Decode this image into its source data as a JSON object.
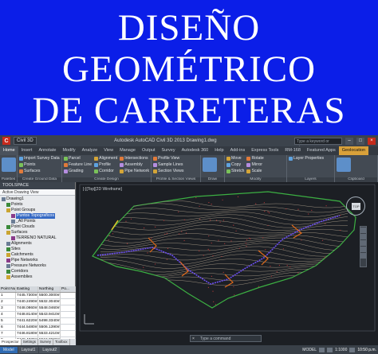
{
  "banner": {
    "line1": "DISEÑO",
    "line2": "GEOMÉTRICO",
    "line3": "DE CARRETERAS"
  },
  "titlebar": {
    "workspace": "Civil 3D",
    "document": "Autodesk AutoCAD Civil 3D 2013   Drawing1.dwg",
    "search_placeholder": "Type a keyword or phrase"
  },
  "ribbon_tabs": [
    "Home",
    "Insert",
    "Annotate",
    "Modify",
    "Analyze",
    "View",
    "Manage",
    "Output",
    "Survey",
    "Autodesk 360",
    "Help",
    "Add-ins",
    "Express Tools",
    "RM-168",
    "Featured Apps",
    "Geolocation"
  ],
  "ribbon_groups": [
    {
      "label": "Palettes",
      "items": []
    },
    {
      "label": "Create Ground Data",
      "items": [
        "Import Survey Data",
        "Points",
        "Surfaces"
      ]
    },
    {
      "label": "Create Design",
      "items": [
        "Parcel",
        "Feature Line",
        "Grading",
        "Alignment",
        "Profile",
        "Corridor",
        "Intersections",
        "Assembly",
        "Pipe Network"
      ]
    },
    {
      "label": "Profile & Section Views",
      "items": [
        "Profile View",
        "Sample Lines",
        "Section Views"
      ]
    },
    {
      "label": "Draw",
      "items": []
    },
    {
      "label": "Modify",
      "items": [
        "Move",
        "Copy",
        "Stretch",
        "Rotate",
        "Mirror",
        "Scale"
      ]
    },
    {
      "label": "Layers",
      "items": [
        "Layer Properties"
      ]
    },
    {
      "label": "Clipboard",
      "items": []
    }
  ],
  "toolspace": {
    "header": "TOOLSPACE",
    "mode": "Active Drawing View",
    "tree": [
      {
        "label": "Drawing1",
        "level": 0
      },
      {
        "label": "Points",
        "level": 1
      },
      {
        "label": "Point Groups",
        "level": 1
      },
      {
        "label": "Puntos Topograficos",
        "level": 2,
        "selected": true
      },
      {
        "label": "_All Points",
        "level": 2
      },
      {
        "label": "Point Clouds",
        "level": 1
      },
      {
        "label": "Surfaces",
        "level": 1
      },
      {
        "label": "TERRENO NATURAL",
        "level": 2
      },
      {
        "label": "Alignments",
        "level": 1
      },
      {
        "label": "Sites",
        "level": 1
      },
      {
        "label": "Catchments",
        "level": 1
      },
      {
        "label": "Pipe Networks",
        "level": 1
      },
      {
        "label": "Pressure Networks",
        "level": 1
      },
      {
        "label": "Corridors",
        "level": 1
      },
      {
        "label": "Assemblies",
        "level": 1
      }
    ],
    "table": {
      "headers": [
        "Point Nu...",
        "Easting",
        "Northing",
        "Po..."
      ],
      "rows": [
        [
          "1",
          "7445.7300m",
          "5500.3000m",
          ""
        ],
        [
          "2",
          "7440.2490m",
          "5532.3040m",
          ""
        ],
        [
          "3",
          "7448.0860m",
          "5548.0460m",
          ""
        ],
        [
          "4",
          "7448.8140m",
          "5543.9410m",
          ""
        ],
        [
          "5",
          "7441.6220m",
          "5498.3340m",
          ""
        ],
        [
          "6",
          "7444.5480m",
          "5506.1390m",
          ""
        ],
        [
          "7",
          "7446.8180m",
          "5533.4210m",
          ""
        ],
        [
          "8",
          "7448.4330m",
          "5519.0960m",
          ""
        ]
      ]
    },
    "side_tabs": [
      "Prospector",
      "Settings",
      "Survey",
      "Toolbox"
    ]
  },
  "viewport": {
    "label": "[-][Top][2D Wireframe]",
    "viewcube_face": "TOP",
    "command_placeholder": "Type a command"
  },
  "layout_tabs": [
    "Model",
    "Layout1",
    "Layout2"
  ],
  "status": {
    "model_label": "MODEL",
    "scale": "1:1000",
    "time": "10:50 p.m."
  },
  "colors": {
    "banner_bg": "#0b1ee8",
    "contour": "#9a8f7e",
    "boundary": "#3cb043",
    "alignment": "#6a4df0",
    "markers": "#e06a1a"
  }
}
